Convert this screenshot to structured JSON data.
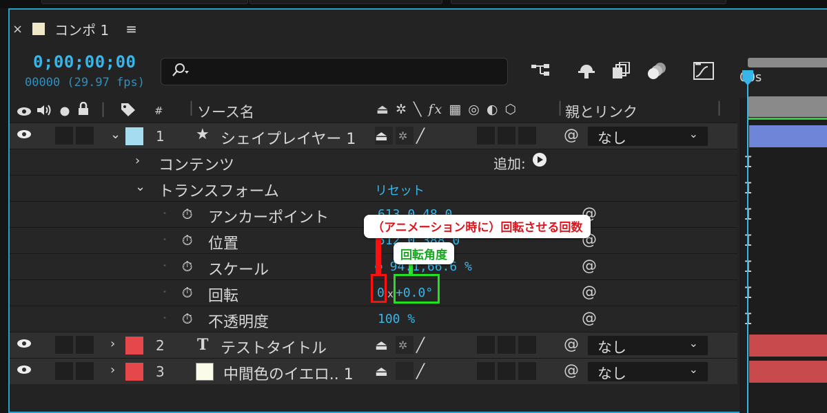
{
  "panel": {
    "tab_close": "×",
    "tab_title": "コンポ 1",
    "tab_menu": "≡",
    "timecode": "0;00;00;00",
    "frames": "00000 (29.97 fps)",
    "search_placeholder": "",
    "timeline_label": "00s"
  },
  "icons": {
    "search": "search-icon",
    "flowchart": "flowchart-icon",
    "shy": "shy-icon",
    "frame_blend": "frame-blend-icon",
    "motion_blur": "motion-blur-icon",
    "graph_editor": "graph-editor-icon"
  },
  "columns": {
    "source_name": "ソース名",
    "parent_link": "親とリンク",
    "hash": "#"
  },
  "layers": [
    {
      "number": "1",
      "name": "シェイプレイヤー 1",
      "label_color": "#a6dcf0",
      "parent": "なし",
      "bar_color": "#6f86d8"
    },
    {
      "number": "2",
      "name": "テストタイトル",
      "label_color": "#e6474a",
      "parent": "なし",
      "bar_color": "#c84a4d"
    },
    {
      "number": "3",
      "name": "中間色のイエロ.. 1",
      "label_color": "#e6474a",
      "parent": "なし",
      "bar_color": "#c84a4d"
    }
  ],
  "properties": {
    "contents": "コンテンツ",
    "add_label": "追加:",
    "transform": "トランスフォーム",
    "reset": "リセット",
    "anchor": "アンカーポイント",
    "anchor_value": "613.0,48.0",
    "position": "位置",
    "position_value": "512.0,388.0",
    "scale": "スケール",
    "scale_value": "∞ 94.1,66.6 %",
    "rotation": "回転",
    "rotation_turns": "0",
    "rotation_x": "x",
    "rotation_degrees": "+0.0°",
    "opacity": "不透明度",
    "opacity_value": "100 %"
  },
  "annotations": {
    "turns_note": "（アニメーション時に）回転させる回数",
    "degree_note": "回転角度",
    "turns_color": "#ff1010",
    "degree_color": "#22e022"
  },
  "colors": {
    "accent_blue": "#38b6ea",
    "panel_border": "#2a9fc9",
    "work_area_green": "#2fd040"
  }
}
